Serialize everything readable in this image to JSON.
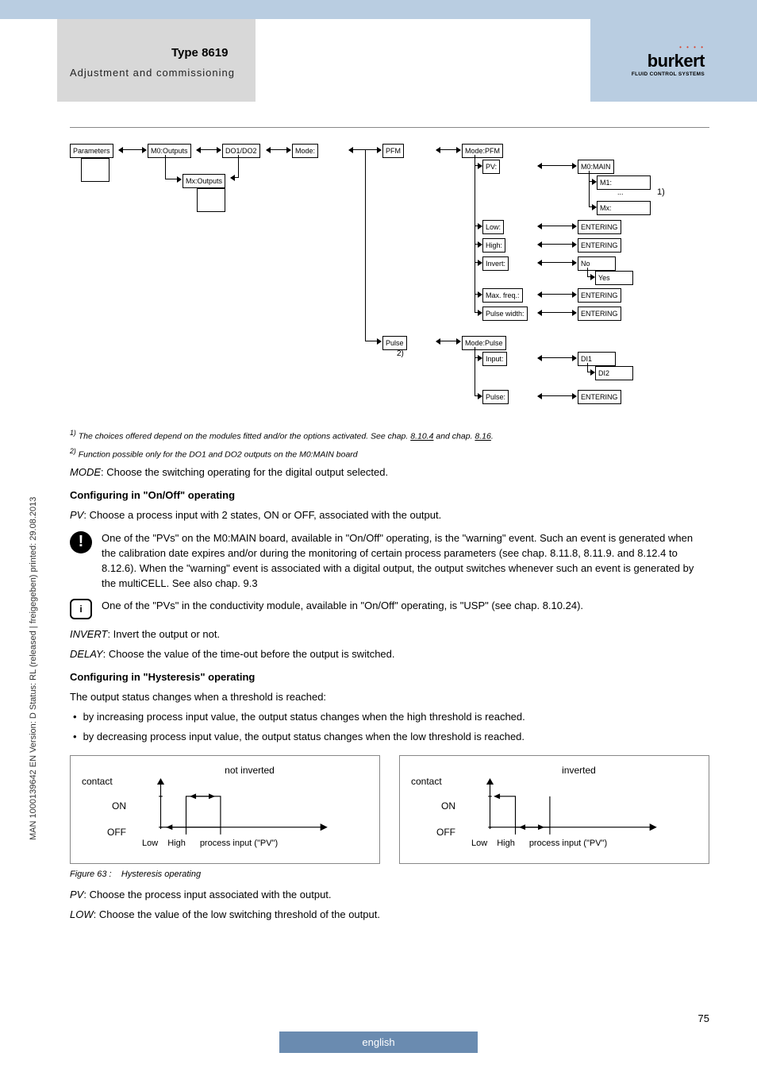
{
  "header": {
    "type_title": "Type 8619",
    "subtitle": "Adjustment and commissioning",
    "logo": {
      "text": "burkert",
      "tagline": "FLUID CONTROL SYSTEMS"
    }
  },
  "diagram": {
    "col1": {
      "parameters": "Parameters"
    },
    "col2": {
      "m0": "M0:Outputs",
      "mx": "Mx:Outputs"
    },
    "col3": {
      "do": "DO1/DO2"
    },
    "col4": {
      "mode": "Mode:"
    },
    "col5": {
      "pfm": "PFM",
      "pulse": "Pulse"
    },
    "note2": "2)",
    "pfm_group": {
      "mode": "Mode:PFM",
      "pv": "PV:",
      "low": "Low:",
      "high": "High:",
      "invert": "Invert:",
      "maxfreq": "Max. freq.:",
      "pulsewidth": "Pulse width:"
    },
    "pfm_right": {
      "m0main": "M0:MAIN",
      "m1": "M1:",
      "dots": "...",
      "mx": "Mx:",
      "note1": "1)",
      "entering": "ENTERING",
      "no": "No",
      "yes": "Yes"
    },
    "pulse_group": {
      "mode": "Mode:Pulse",
      "input": "Input:",
      "pulse": "Pulse:"
    },
    "pulse_right": {
      "di1": "DI1",
      "di2": "DI2",
      "entering": "ENTERING"
    }
  },
  "footnotes": {
    "f1_text": "The choices offered depend on the modules fitted and/or the options activated. See chap.",
    "f1_link1": "8.10.4",
    "f1_and": "and chap.",
    "f1_link2": "8.16",
    "f1_sup": "1)",
    "f2_text": "Function possible only for the DO1 and DO2 outputs on the M0:MAIN board",
    "f2_sup": "2)"
  },
  "body": {
    "mode_label": "MODE",
    "mode_text": ": Choose the switching operating for the digital output selected.",
    "on_off_head": "Configuring in \"On/Off\" operating",
    "pv_label": "PV",
    "pv_text": ": Choose a process input with 2 states, ON or OFF, associated with the output.",
    "warn_text_1": "One of the \"PVs\" on the M0:MAIN board, available in \"On/Off\" operating, is the \"warning\" event. Such an event is generated when the calibration date expires and/or during the monitoring of certain process parameters (see chap. ",
    "warn_link_1": "8.11.8",
    "warn_comma1": ", ",
    "warn_link_2": "8.11.9.",
    "warn_and": " and ",
    "warn_link_3": "8.12.4",
    "warn_to": " to ",
    "warn_link_4": "8.12.6",
    "warn_text_2": "). When the \"warning\" event is associated with a digital output, the output switches whenever such an event is generated by the multiCELL. See also chap. ",
    "warn_link_5": "9.3",
    "info_text_1": "One of the \"PVs\" in the conductivity module, available in \"On/Off\" operating, is \"USP\" (see chap. ",
    "info_link_1": "8.10.24",
    "info_text_2": ").",
    "invert_label": "INVERT",
    "invert_text": ": Invert the output or not.",
    "delay_label": "DELAY",
    "delay_text": ": Choose the value of the time-out before the output is switched.",
    "hyst_head": "Configuring in \"Hysteresis\" operating",
    "hyst_intro": "The output status changes when a threshold is reached:",
    "bullet1": "by increasing process input value, the output status changes when the high threshold  is reached.",
    "bullet2": "by decreasing process input value, the output status changes when the low threshold is reached.",
    "hyst_left": {
      "title": "not inverted",
      "contact": "contact",
      "on": "ON",
      "off": "OFF",
      "low": "Low",
      "high": "High",
      "xlabel": "process input (\"PV\")"
    },
    "hyst_right": {
      "title": "inverted",
      "contact": "contact",
      "on": "ON",
      "off": "OFF",
      "low": "Low",
      "high": "High",
      "xlabel": "process input (\"PV\")"
    },
    "figcap_n": "Figure 63 :",
    "figcap_t": "Hysteresis operating",
    "pv2_text": ": Choose the process input associated with the output.",
    "low_label": "LOW",
    "low_text": ": Choose the value of the low switching threshold of the output."
  },
  "side_text": "MAN 1000139642 EN Version: D Status: RL (released | freigegeben) printed: 29.08.2013",
  "page_number": "75",
  "footer_lang": "english"
}
